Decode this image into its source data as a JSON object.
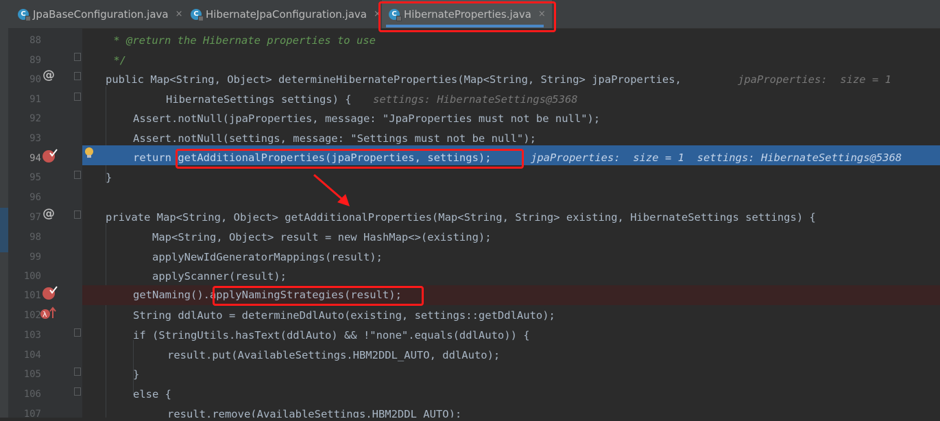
{
  "tabs": [
    {
      "label": "JpaBaseConfiguration.java",
      "active": false,
      "icon": "class-c-icon"
    },
    {
      "label": "HibernateJpaConfiguration.java",
      "active": false,
      "icon": "class-c-icon"
    },
    {
      "label": "HibernateProperties.java",
      "active": true,
      "icon": "class-c-icon"
    }
  ],
  "tab_close_glyph": "×",
  "gutter_marks": {
    "override": "@",
    "breakpoint": "breakpoint-check-icon",
    "lambda": "lambda-up-icon"
  },
  "lines": [
    {
      "num": "88",
      "text": " * @return the Hibernate properties to use"
    },
    {
      "num": "89",
      "text": " */"
    },
    {
      "num": "90",
      "text": "public Map<String, Object> determineHibernateProperties(Map<String, String> jpaProperties,",
      "hint": "jpaProperties:  size = 1"
    },
    {
      "num": "91",
      "text": "      HibernateSettings settings) {",
      "hint": "settings: HibernateSettings@5368"
    },
    {
      "num": "92",
      "text": "   Assert.notNull(jpaProperties, message: \"JpaProperties must not be null\");",
      "param_hint": "message:"
    },
    {
      "num": "93",
      "text": "   Assert.notNull(settings, message: \"Settings must not be null\");",
      "param_hint": "message:"
    },
    {
      "num": "94",
      "text": "   return getAdditionalProperties(jpaProperties, settings);",
      "hint": "jpaProperties:  size = 1  settings: HibernateSettings@5368"
    },
    {
      "num": "95",
      "text": "}"
    },
    {
      "num": "96",
      "text": ""
    },
    {
      "num": "97",
      "text": "private Map<String, Object> getAdditionalProperties(Map<String, String> existing, HibernateSettings settings) {"
    },
    {
      "num": "98",
      "text": "   Map<String, Object> result = new HashMap<>(existing);"
    },
    {
      "num": "99",
      "text": "   applyNewIdGeneratorMappings(result);"
    },
    {
      "num": "100",
      "text": "   applyScanner(result);"
    },
    {
      "num": "101",
      "text": "   getNaming().applyNamingStrategies(result);"
    },
    {
      "num": "102",
      "text": "   String ddlAuto = determineDdlAuto(existing, settings::getDdlAuto);"
    },
    {
      "num": "103",
      "text": "   if (StringUtils.hasText(ddlAuto) && !\"none\".equals(ddlAuto)) {"
    },
    {
      "num": "104",
      "text": "      result.put(AvailableSettings.HBM2DDL_AUTO, ddlAuto);"
    },
    {
      "num": "105",
      "text": "   }"
    },
    {
      "num": "106",
      "text": "   else {"
    },
    {
      "num": "107",
      "text": "      result.remove(AvailableSettings.HBM2DDL_AUTO);"
    }
  ],
  "colors": {
    "annotation_red": "#ff1a1a",
    "exec_line": "#2d6099",
    "breakpoint_line": "#3a2323",
    "keyword": "#cc7832",
    "method": "#ffc66d",
    "string": "#6a8759",
    "comment": "#629755"
  }
}
